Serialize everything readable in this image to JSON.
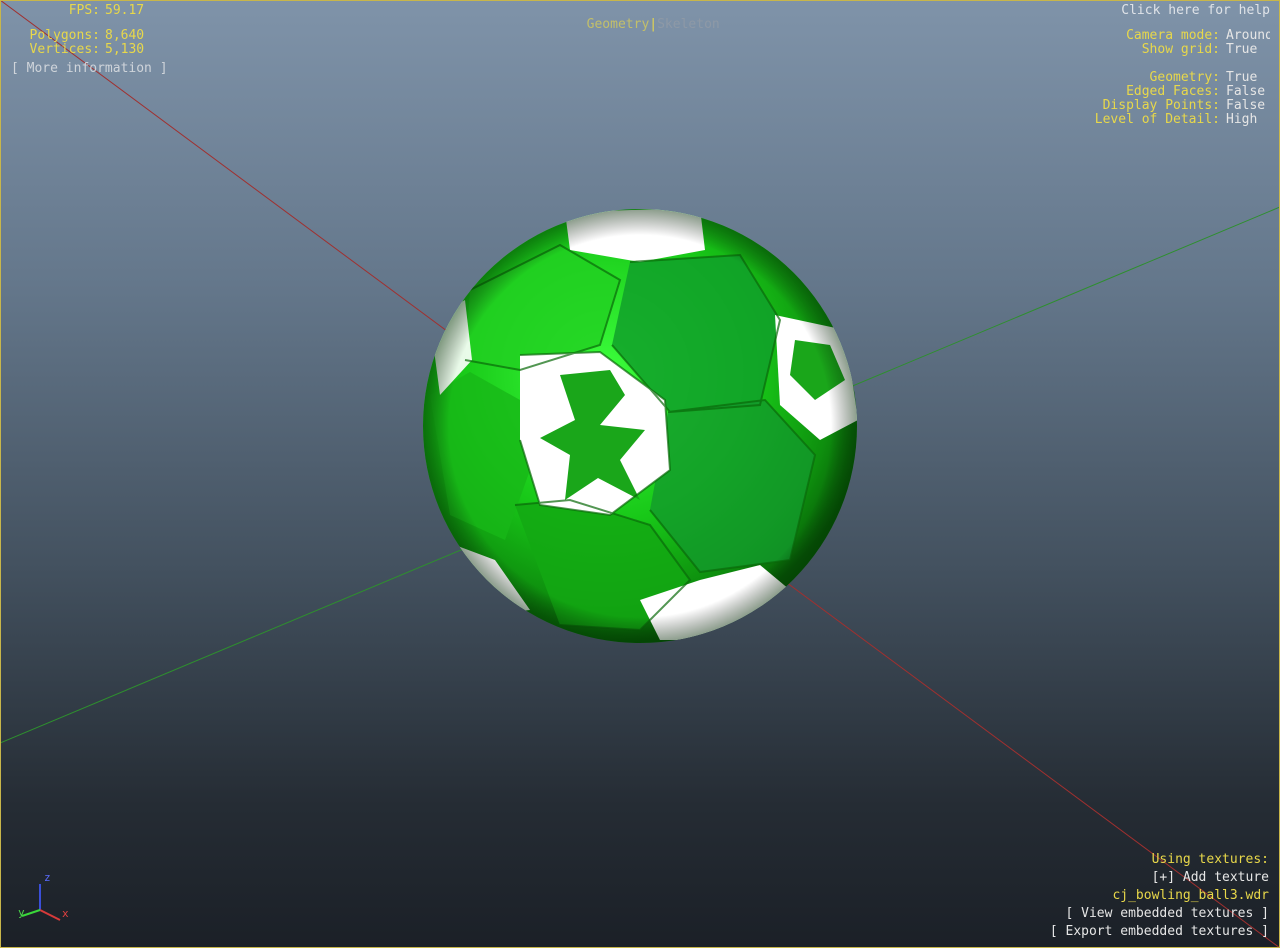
{
  "stats": {
    "fps_label": "FPS:",
    "fps_value": "59.17",
    "polygons_label": "Polygons:",
    "polygons_value": "8,640",
    "vertices_label": "Vertices:",
    "vertices_value": "5,130",
    "more_info": "[ More information ]"
  },
  "mode_toggle": {
    "geometry": "Geometry",
    "separator": "|",
    "skeleton": "Skeleton"
  },
  "help_link": "Click here for help",
  "settings": {
    "camera_mode_label": "Camera mode:",
    "camera_mode_value": "Around",
    "show_grid_label": "Show grid:",
    "show_grid_value": "True",
    "geometry_label": "Geometry:",
    "geometry_value": "True",
    "edged_faces_label": "Edged Faces:",
    "edged_faces_value": "False",
    "display_points_label": "Display Points:",
    "display_points_value": "False",
    "lod_label": "Level of Detail:",
    "lod_value": "High"
  },
  "textures": {
    "heading": "Using textures:",
    "add": "[+] Add texture",
    "file": "cj_bowling_ball3.wdr",
    "view": "[ View embedded textures ]",
    "export": "[ Export embedded textures ]"
  },
  "axis_gizmo": {
    "z": "z",
    "y": "y",
    "x": "x"
  },
  "colors": {
    "accent": "#e8d84a",
    "ball_green": "#1fc21f",
    "grid_red": "#a0302f",
    "grid_green": "#2e8f2e"
  }
}
